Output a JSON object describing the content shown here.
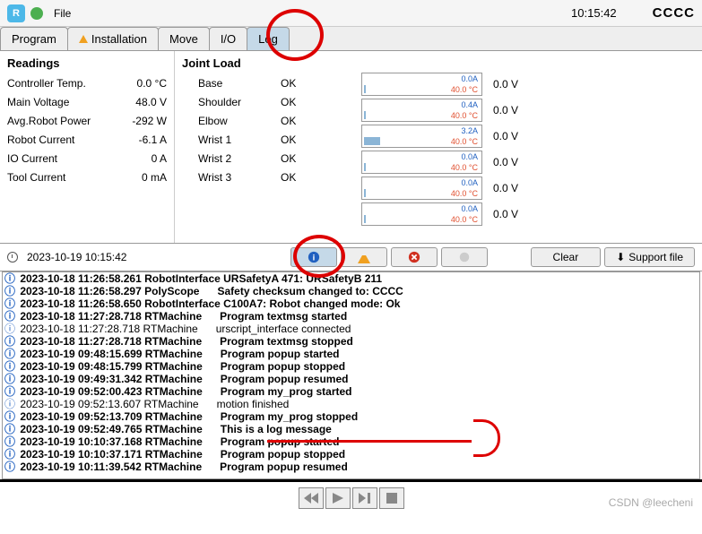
{
  "topbar": {
    "file_label": "File",
    "time": "10:15:42",
    "status": "CCCC"
  },
  "tabs": [
    {
      "label": "Program"
    },
    {
      "label": "Installation"
    },
    {
      "label": "Move"
    },
    {
      "label": "I/O"
    },
    {
      "label": "Log"
    }
  ],
  "readings": {
    "title": "Readings",
    "rows": [
      {
        "label": "Controller Temp.",
        "value": "0.0",
        "unit": "°C"
      },
      {
        "label": "Main Voltage",
        "value": "48.0",
        "unit": "V"
      },
      {
        "label": "Avg.Robot Power",
        "value": "-292",
        "unit": "W"
      },
      {
        "label": "Robot Current",
        "value": "-6.1",
        "unit": "A"
      },
      {
        "label": "IO Current",
        "value": "0",
        "unit": "A"
      },
      {
        "label": "Tool Current",
        "value": "0",
        "unit": "mA"
      }
    ]
  },
  "joints": {
    "title": "Joint Load",
    "rows": [
      {
        "name": "Base",
        "status": "OK"
      },
      {
        "name": "Shoulder",
        "status": "OK"
      },
      {
        "name": "Elbow",
        "status": "OK"
      },
      {
        "name": "Wrist 1",
        "status": "OK"
      },
      {
        "name": "Wrist 2",
        "status": "OK"
      },
      {
        "name": "Wrist 3",
        "status": "OK"
      }
    ]
  },
  "meters": [
    {
      "amps": "0.0A",
      "temp": "40.0 °C",
      "volts": "0.0 V",
      "fill": 2
    },
    {
      "amps": "0.4A",
      "temp": "40.0 °C",
      "volts": "0.0 V",
      "fill": 2
    },
    {
      "amps": "3.2A",
      "temp": "40.0 °C",
      "volts": "0.0 V",
      "fill": 18
    },
    {
      "amps": "0.0A",
      "temp": "40.0 °C",
      "volts": "0.0 V",
      "fill": 2
    },
    {
      "amps": "0.0A",
      "temp": "40.0 °C",
      "volts": "0.0 V",
      "fill": 2
    },
    {
      "amps": "0.0A",
      "temp": "40.0 °C",
      "volts": "0.0 V",
      "fill": 2
    }
  ],
  "log_timestamp": "2023-10-19 10:15:42",
  "buttons": {
    "clear": "Clear",
    "support": "Support file"
  },
  "loglines": [
    {
      "ts": "2023-10-18 11:26:58.261",
      "src": "RobotInterface",
      "msg": "URSafetyA 471: URSafetyB 211",
      "bold": true
    },
    {
      "ts": "2023-10-18 11:26:58.297",
      "src": "PolyScope     ",
      "msg": "Safety checksum changed to: CCCC",
      "bold": true
    },
    {
      "ts": "2023-10-18 11:26:58.650",
      "src": "RobotInterface",
      "msg": "C100A7: Robot changed mode: Ok",
      "bold": true
    },
    {
      "ts": "2023-10-18 11:27:28.718",
      "src": "RTMachine     ",
      "msg": "Program textmsg started",
      "bold": true
    },
    {
      "ts": "2023-10-18 11:27:28.718",
      "src": "RTMachine     ",
      "msg": "urscript_interface connected",
      "bold": false
    },
    {
      "ts": "2023-10-18 11:27:28.718",
      "src": "RTMachine     ",
      "msg": "Program textmsg stopped",
      "bold": true
    },
    {
      "ts": "2023-10-19 09:48:15.699",
      "src": "RTMachine     ",
      "msg": "Program popup started",
      "bold": true
    },
    {
      "ts": "2023-10-19 09:48:15.799",
      "src": "RTMachine     ",
      "msg": "Program popup stopped",
      "bold": true
    },
    {
      "ts": "2023-10-19 09:49:31.342",
      "src": "RTMachine     ",
      "msg": "Program popup resumed",
      "bold": true
    },
    {
      "ts": "2023-10-19 09:52:00.423",
      "src": "RTMachine     ",
      "msg": "Program my_prog started",
      "bold": true
    },
    {
      "ts": "2023-10-19 09:52:13.607",
      "src": "RTMachine     ",
      "msg": "motion finished",
      "bold": false
    },
    {
      "ts": "2023-10-19 09:52:13.709",
      "src": "RTMachine     ",
      "msg": "Program my_prog stopped",
      "bold": true
    },
    {
      "ts": "2023-10-19 09:52:49.765",
      "src": "RTMachine     ",
      "msg": "This is a log message",
      "bold": true
    },
    {
      "ts": "2023-10-19 10:10:37.168",
      "src": "RTMachine     ",
      "msg": "Program popup started",
      "bold": true
    },
    {
      "ts": "2023-10-19 10:10:37.171",
      "src": "RTMachine     ",
      "msg": "Program popup stopped",
      "bold": true
    },
    {
      "ts": "2023-10-19 10:11:39.542",
      "src": "RTMachine     ",
      "msg": "Program popup resumed",
      "bold": true
    }
  ],
  "watermark": "CSDN @leecheni"
}
